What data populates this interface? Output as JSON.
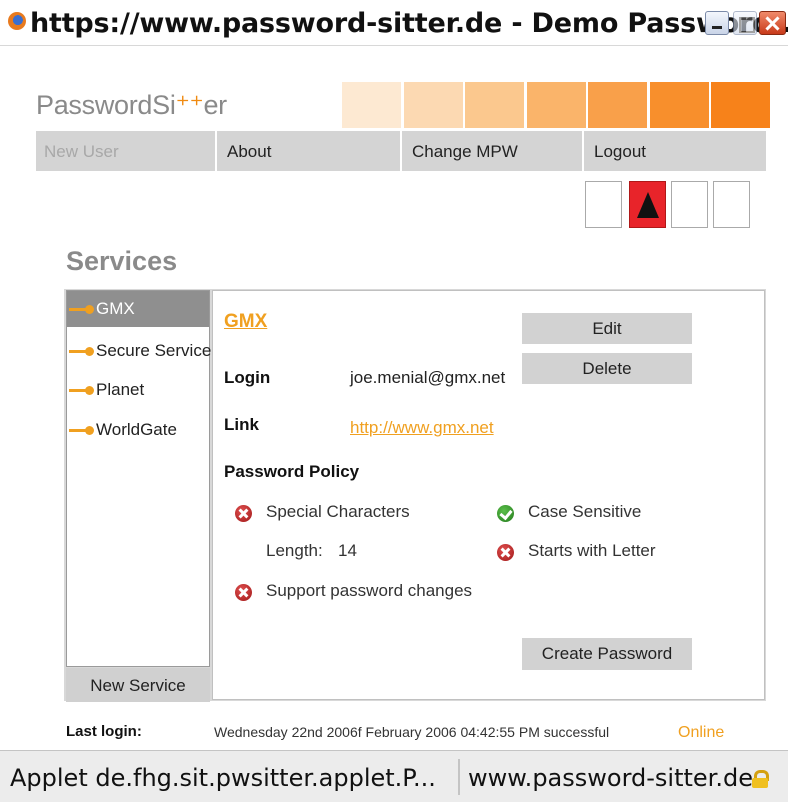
{
  "window": {
    "title": "https://www.password-sitter.de - Demo Password..."
  },
  "logo": {
    "text_before": "PasswordSi",
    "text_mark": "⁺⁺",
    "text_after": "er"
  },
  "header": {
    "gradient_colors": [
      "#fde9d2",
      "#fcd9b2",
      "#fbc88e",
      "#fab46a",
      "#f9a04a",
      "#f88f2c",
      "#f7821a"
    ]
  },
  "nav": {
    "items": [
      {
        "label": "New User",
        "enabled": false
      },
      {
        "label": "About",
        "enabled": true
      },
      {
        "label": "Change MPW",
        "enabled": true
      },
      {
        "label": "Logout",
        "enabled": true
      }
    ]
  },
  "strength_indicator": {
    "levels": 4,
    "active_index": 1,
    "active_color": "#e8242a"
  },
  "services": {
    "title": "Services",
    "items": [
      {
        "label": "GMX",
        "selected": true
      },
      {
        "label": "Secure Service",
        "selected": false
      },
      {
        "label": "Planet",
        "selected": false
      },
      {
        "label": "WorldGate",
        "selected": false
      }
    ],
    "new_service_label": "New Service"
  },
  "detail": {
    "service_name": "GMX",
    "login_label": "Login",
    "login_value": "joe.menial@gmx.net",
    "link_label": "Link",
    "link_value": "http://www.gmx.net",
    "edit_label": "Edit",
    "delete_label": "Delete",
    "policy_title": "Password Policy",
    "policy": {
      "special_characters": {
        "label": "Special Characters",
        "ok": false
      },
      "length_label": "Length:",
      "length_value": "14",
      "support_changes": {
        "label": "Support password changes",
        "ok": false
      },
      "case_sensitive": {
        "label": "Case Sensitive",
        "ok": true
      },
      "starts_with_letter": {
        "label": "Starts with Letter",
        "ok": false
      }
    },
    "create_password_label": "Create Password"
  },
  "footer": {
    "last_login_label": "Last login:",
    "last_login_value": "Wednesday 22nd 2006f February 2006 04:42:55 PM successful",
    "online_label": "Online"
  },
  "statusbar": {
    "left_text": "Applet de.fhg.sit.pwsitter.applet.P...",
    "right_text": "www.password-sitter.de"
  },
  "colors": {
    "accent": "#f0a020",
    "nav_bg": "#d4d4d4"
  }
}
